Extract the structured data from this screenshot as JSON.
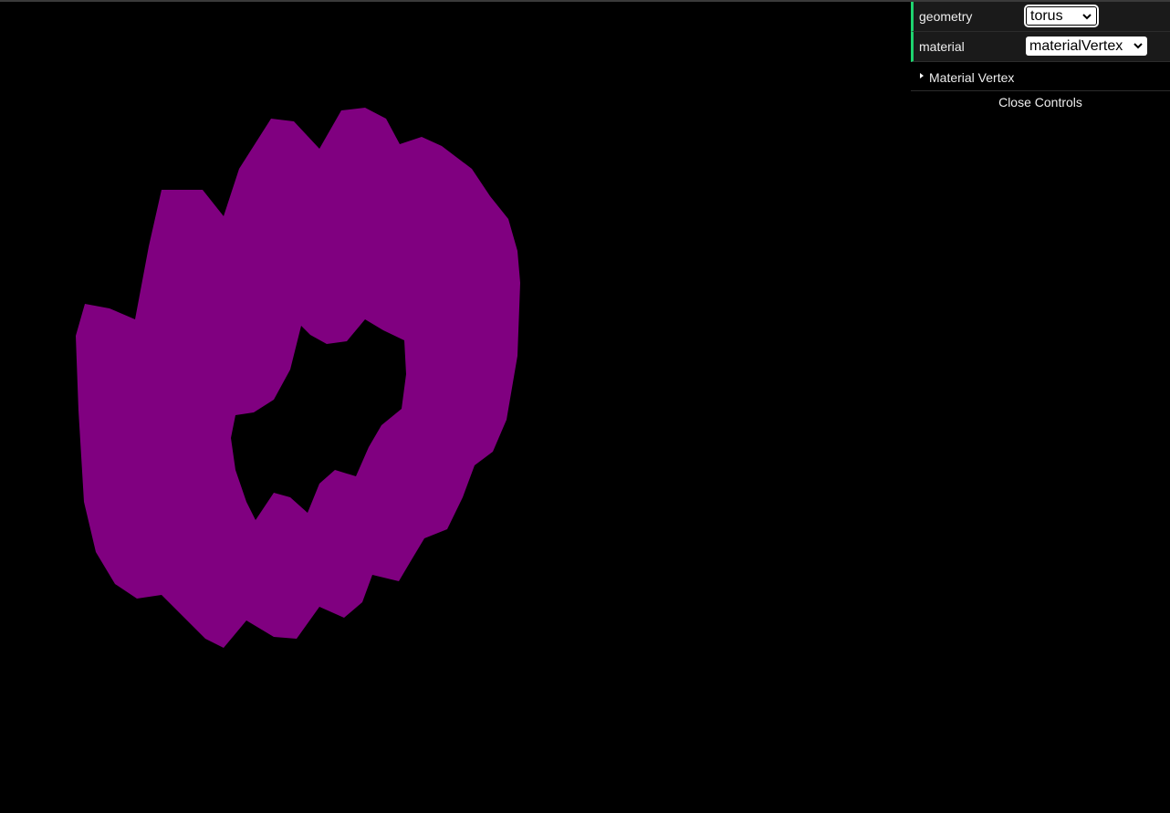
{
  "scene": {
    "background_color": "#000000",
    "mesh_color": "#800080"
  },
  "gui": {
    "controllers": [
      {
        "label": "geometry",
        "value": "torus"
      },
      {
        "label": "material",
        "value": "materialVertex"
      }
    ],
    "folder": {
      "label": "Material Vertex",
      "collapsed": true
    },
    "close_label": "Close Controls",
    "accent_color": "#1ed36f"
  }
}
